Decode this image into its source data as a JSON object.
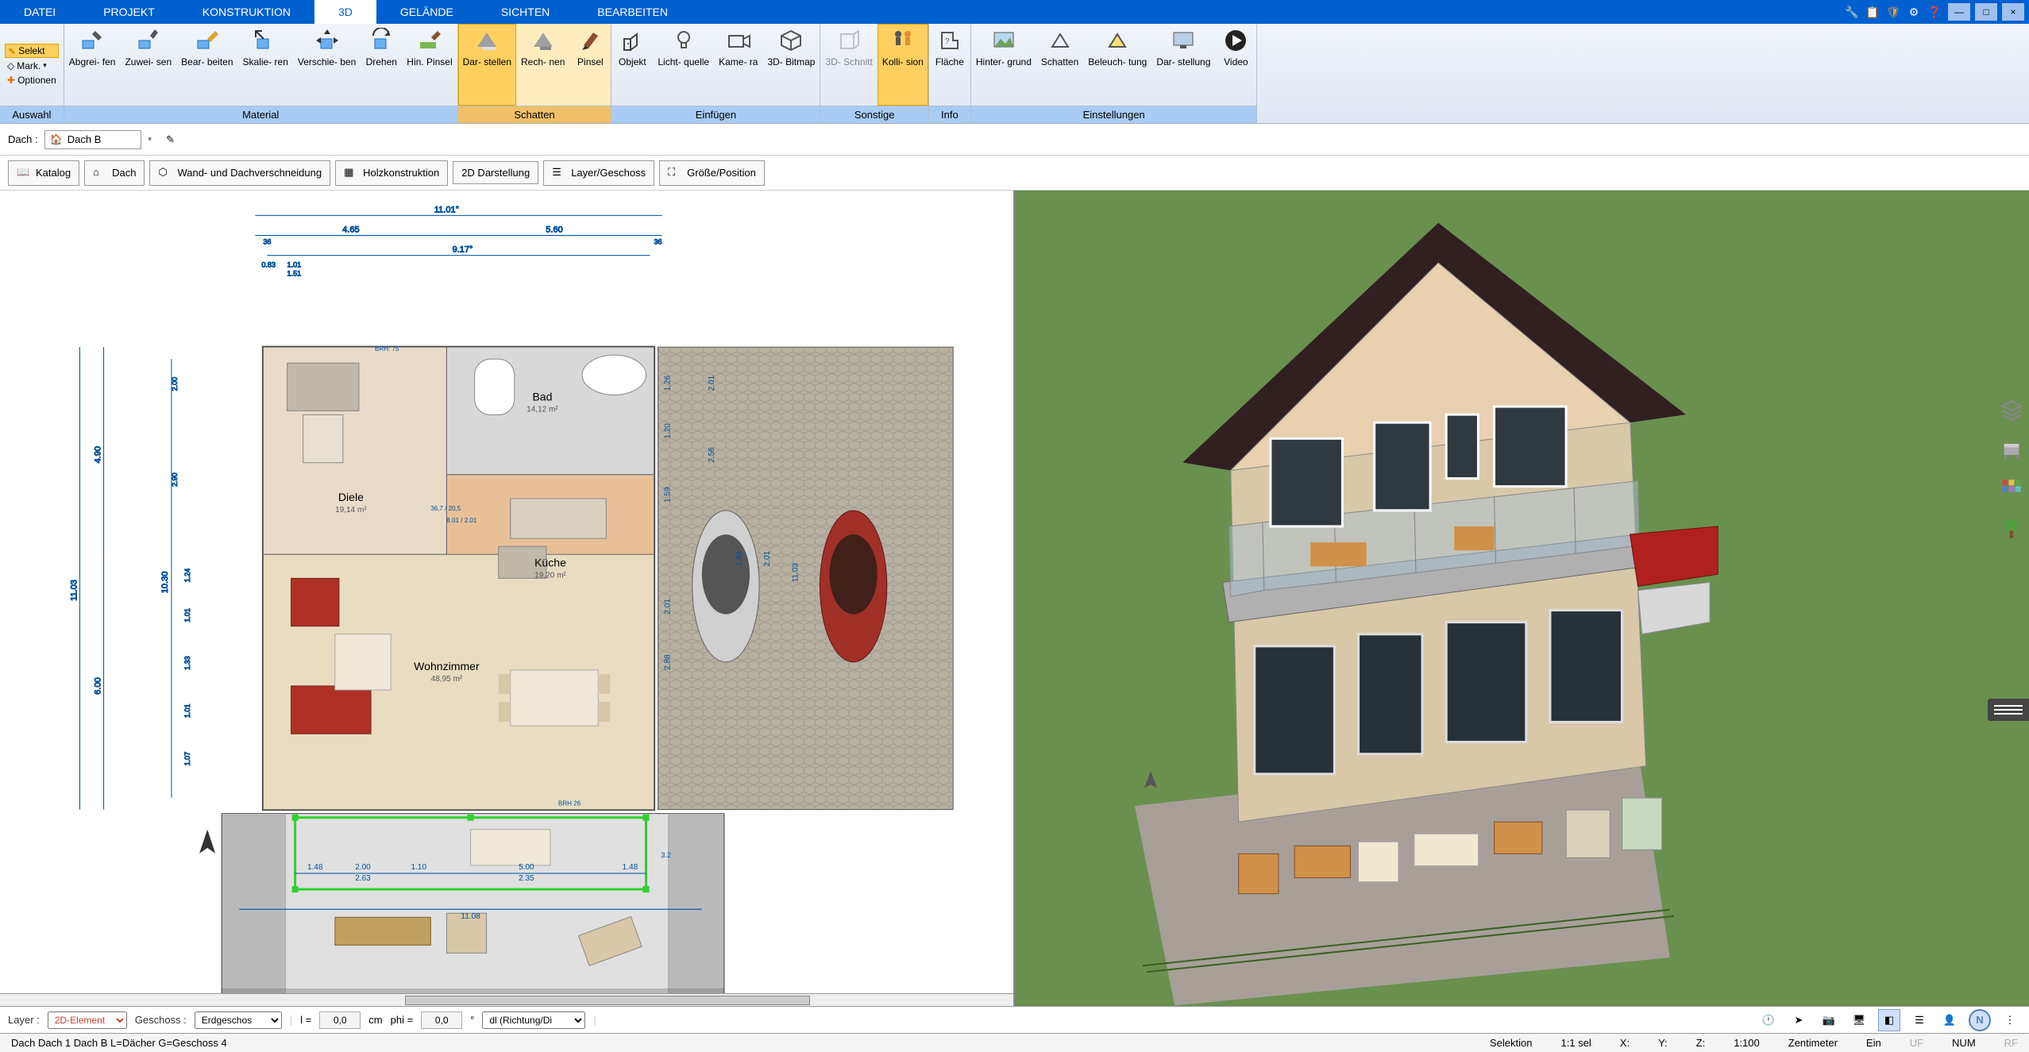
{
  "menu": {
    "tabs": [
      "DATEI",
      "PROJEKT",
      "KONSTRUKTION",
      "3D",
      "GELÄNDE",
      "SICHTEN",
      "BEARBEITEN"
    ],
    "active": "3D"
  },
  "ribbon": {
    "auswahl": {
      "label": "Auswahl",
      "selekt": "Selekt",
      "mark": "Mark.",
      "optionen": "Optionen"
    },
    "material": {
      "label": "Material",
      "items": [
        "Abgrei-\nfen",
        "Zuwei-\nsen",
        "Bear-\nbeiten",
        "Skalie-\nren",
        "Verschie-\nben",
        "Drehen",
        "Hin.\nPinsel"
      ]
    },
    "schatten": {
      "label": "Schatten",
      "items": [
        "Dar-\nstellen",
        "Rech-\nnen",
        "Pinsel"
      ],
      "active_index": 0
    },
    "einfuegen": {
      "label": "Einfügen",
      "items": [
        "Objekt",
        "Licht-\nquelle",
        "Kame-\nra",
        "3D-\nBitmap"
      ]
    },
    "sonstige": {
      "label": "Sonstige",
      "items": [
        "3D-\nSchnitt",
        "Kolli-\nsion"
      ],
      "active_index": 1,
      "disabled_index": 0
    },
    "info": {
      "label": "Info",
      "items": [
        "Fläche"
      ]
    },
    "einstellungen": {
      "label": "Einstellungen",
      "items": [
        "Hinter-\ngrund",
        "Schatten",
        "Beleuch-\ntung",
        "Dar-\nstellung",
        "Video"
      ]
    }
  },
  "toolbar2": {
    "dach_label": "Dach :",
    "dach_value": "Dach B"
  },
  "toolbar3": {
    "buttons": [
      "Katalog",
      "Dach",
      "Wand- und Dachverschneidung",
      "Holzkonstruktion",
      "2D Darstellung",
      "Layer/Geschoss",
      "Größe/Position"
    ]
  },
  "floorplan": {
    "rooms": [
      {
        "name": "Bad",
        "area": "14,12 m²"
      },
      {
        "name": "Diele",
        "area": "19,14 m²"
      },
      {
        "name": "Küche",
        "area": "19,20 m²"
      },
      {
        "name": "Wohnzimmer",
        "area": "48,95 m²"
      }
    ],
    "dims_top": {
      "total": "11.01°",
      "left": "4.65",
      "right": "5.60",
      "outers": [
        "36",
        "36"
      ],
      "second_total": "9.17°",
      "small_left_top": "0.83",
      "small_left_bot": "1.01",
      "small_left_bot2": "1.51"
    },
    "dims_left": {
      "total": "11.03",
      "upper": "4.90",
      "lower": "6.00",
      "inner_top": "2.00",
      "inner_mid": "2.90",
      "inner": "10.30",
      "seg_a": "1.24",
      "seg_b": "1.01",
      "seg_c": "1.33",
      "seg_d": "1.01",
      "seg_e": "1.07"
    },
    "dims_inner": {
      "a": "2.01",
      "b": "2.56",
      "c": "1.26",
      "d": "1.20",
      "e": "1.59",
      "f": "2.01",
      "g": "2.88",
      "h": "11.03",
      "i": "2.01",
      "j": "1.94"
    },
    "dims_bottom": {
      "seg1": "1.48",
      "seg2": "2.00",
      "seg2b": "2.63",
      "seg3": "1.10",
      "seg4": "5.00",
      "seg4b": "2.35",
      "seg5": "1.48",
      "seg_r": "3.2",
      "total": "11.08"
    },
    "small_dims": {
      "a": "36,7 / 20,5",
      "b": "8.01 / 2.01",
      "brh": "BRH 26",
      "brh2": "BRH: 75"
    }
  },
  "bottom": {
    "layer_label": "Layer :",
    "layer_value": "2D-Element",
    "geschoss_label": "Geschoss :",
    "geschoss_value": "Erdgeschos",
    "l_label": "l =",
    "l_value": "0,0",
    "l_unit": "cm",
    "phi_label": "phi =",
    "phi_value": "0,0",
    "phi_unit": "°",
    "dl_value": "dl (Richtung/Di"
  },
  "status": {
    "path": "Dach Dach 1 Dach B L=Dächer G=Geschoss 4",
    "selektion": "Selektion",
    "sel": "1:1 sel",
    "x": "X:",
    "y": "Y:",
    "z": "Z:",
    "scale": "1:100",
    "unit": "Zentimeter",
    "ein": "Ein",
    "uf": "UF",
    "num": "NUM",
    "rf": "RF"
  }
}
